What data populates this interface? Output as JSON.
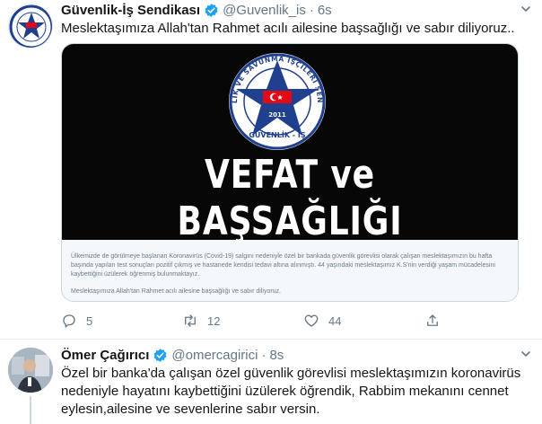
{
  "tweets": [
    {
      "name": "Güvenlik-İş Sendikası",
      "handle": "@Guvenlik_is",
      "separator": "·",
      "time": "6s",
      "text": "Meslektaşımıza Allah'tan Rahmet acılı ailesine başsağlığı ve sabır diliyoruz..",
      "card": {
        "logo_year": "2011",
        "logo_name": "GÜVENLİK - İŞ",
        "logo_arc_text": "GÜVENLİK VE SAVUNMA İŞÇİLERİ SENDİKASI",
        "banner": "VEFAT ve BAŞSAĞLIĞI",
        "body": "Ülkemizde de görülmeye başlanan Koronavirüs (Covid-19) salgını nedeniyle özel bir bankada güvenlik görevlisi olarak çalışan meslektaşımızın bu hafta başında yapılan test sonuçları pozitif çıkmış ve hastanede kendisi tedavi altına alınmıştı. 44 yaşındaki meslektaşımız K.S'nin verdiği yaşam mücadelesini kaybettiğini üzülerek öğrenmiş bulunmaktayız.",
        "footer": "Meslektaşımıza Allah'tan Rahmet acılı ailesine başsağlığı ve sabır diliyoruz."
      },
      "actions": {
        "reply_count": "5",
        "retweet_count": "12",
        "like_count": "44"
      }
    },
    {
      "name": "Ömer Çağırıcı",
      "handle": "@omercagirici",
      "separator": "·",
      "time": "8s",
      "text": "Özel bir banka'da çalışan özel güvenlik görevlisi meslektaşımızın koronavirüs nedeniyle hayatını kaybettiğini üzülerek öğrendik, Rabbim mekanını cennet eylesin,ailesine ve sevenlerine sabır versin."
    }
  ],
  "colors": {
    "accent": "#1da1f2",
    "text": "#14171a",
    "muted": "#657786",
    "border": "#e6ecf0",
    "logo_blue": "#1f3f8f",
    "logo_red": "#e30a17"
  },
  "icons": [
    "verified-icon",
    "caret-down-icon",
    "reply-icon",
    "retweet-icon",
    "like-icon",
    "share-icon"
  ]
}
